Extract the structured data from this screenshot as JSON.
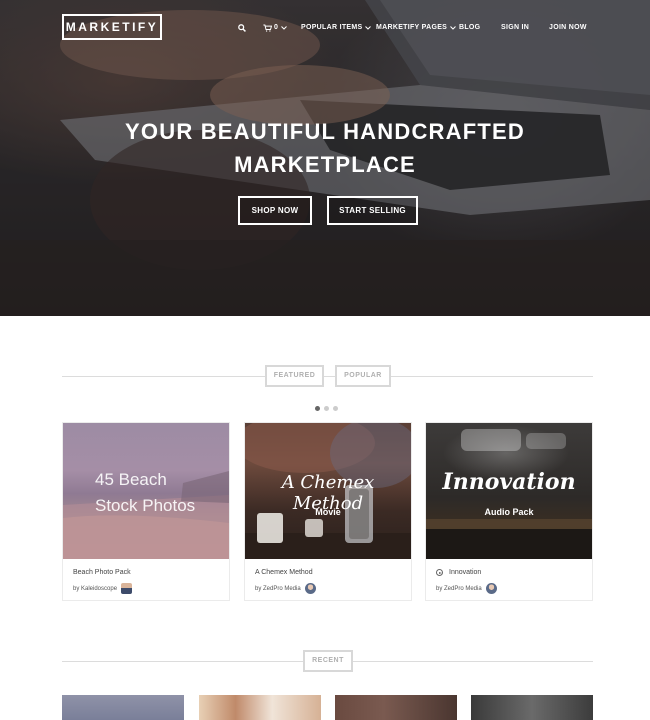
{
  "header": {
    "logo": "MARKETIFY",
    "nav": {
      "search_icon": "search-icon",
      "cart_icon": "cart-icon",
      "cart_count": "0",
      "popular_items": "POPULAR ITEMS",
      "marketify_pages": "MARKETIFY PAGES",
      "blog": "BLOG",
      "sign_in": "SIGN IN",
      "join_now": "JOIN NOW"
    }
  },
  "hero": {
    "title_line1": "YOUR BEAUTIFUL HANDCRAFTED",
    "title_line2": "MARKETPLACE",
    "shop_now": "SHOP NOW",
    "start_selling": "START SELLING"
  },
  "featured": {
    "tabs": [
      "FEATURED",
      "POPULAR"
    ],
    "carousel": {
      "pages": 3,
      "active": 1
    },
    "cards": [
      {
        "image_line1": "45 Beach",
        "image_line2": "Stock Photos",
        "name": "Beach Photo Pack",
        "author": "by Kaleidoscope"
      },
      {
        "image_title": "A Chemex Method",
        "image_sub": "Movie",
        "name": "A Chemex Method",
        "author": "by ZedPro Media"
      },
      {
        "image_title": "Innovation",
        "image_sub": "Audio Pack",
        "name": "Innovation",
        "author": "by ZedPro Media"
      }
    ]
  },
  "recent": {
    "heading": "RECENT"
  },
  "colors": {
    "hero_dark": "#2d2a2c",
    "rule": "#dcdcdc",
    "tab_border": "#d8d8d8",
    "tab_text": "#b0b0b0"
  }
}
